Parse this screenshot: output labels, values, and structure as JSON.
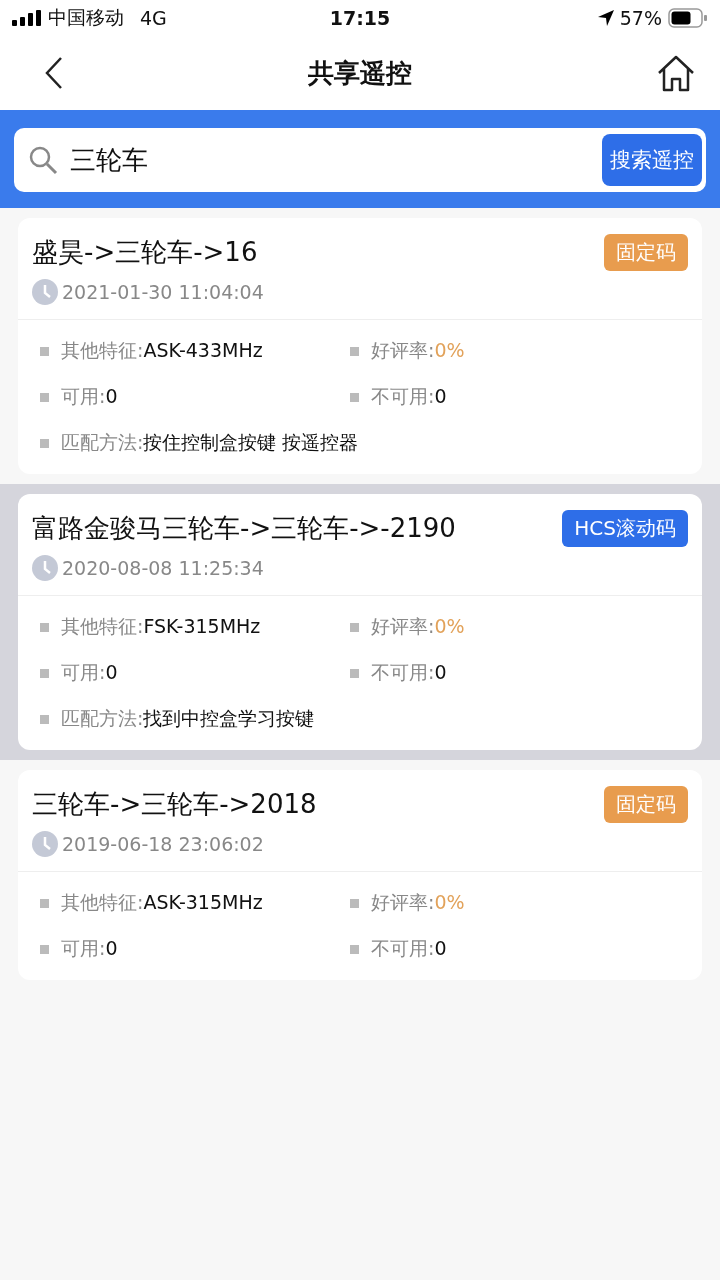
{
  "status_bar": {
    "carrier": "中国移动",
    "network": "4G",
    "time": "17:15",
    "battery": "57%"
  },
  "nav": {
    "title": "共享遥控"
  },
  "search": {
    "value": "三轮车",
    "button": "搜索遥控"
  },
  "results": [
    {
      "title": "盛昊->三轮车->16",
      "tag": "固定码",
      "color": "#e89c4e",
      "date": "2021-01-30 11:04:04",
      "selected": false,
      "fields": [
        {
          "label": "其他特征:",
          "value": "ASK-433MHz",
          "kind": "half"
        },
        {
          "label": "好评率:",
          "value": "0%",
          "kind": "rating"
        },
        {
          "label": "可用:",
          "value": "0",
          "kind": "half"
        },
        {
          "label": "不可用:",
          "value": "0",
          "kind": "half"
        },
        {
          "label": "匹配方法:",
          "value": "按住控制盒按键 按遥控器",
          "kind": "wide"
        }
      ]
    },
    {
      "title": "富路金骏马三轮车->三轮车->-2190",
      "tag": "HCS滚动码",
      "color": "#2e6ee8",
      "date": "2020-08-08 11:25:34",
      "selected": true,
      "fields": [
        {
          "label": "其他特征:",
          "value": "FSK-315MHz",
          "kind": "half"
        },
        {
          "label": "好评率:",
          "value": "0%",
          "kind": "rating"
        },
        {
          "label": "可用:",
          "value": "0",
          "kind": "half"
        },
        {
          "label": "不可用:",
          "value": "0",
          "kind": "half"
        },
        {
          "label": "匹配方法:",
          "value": "找到中控盒学习按键",
          "kind": "wide"
        }
      ]
    },
    {
      "title": "三轮车->三轮车->2018",
      "tag": "固定码",
      "color": "#e89c4e",
      "date": "2019-06-18 23:06:02",
      "selected": false,
      "fields": [
        {
          "label": "其他特征:",
          "value": "ASK-315MHz",
          "kind": "half"
        },
        {
          "label": "好评率:",
          "value": "0%",
          "kind": "rating"
        },
        {
          "label": "可用:",
          "value": "0",
          "kind": "half"
        },
        {
          "label": "不可用:",
          "value": "0",
          "kind": "half"
        }
      ]
    }
  ]
}
